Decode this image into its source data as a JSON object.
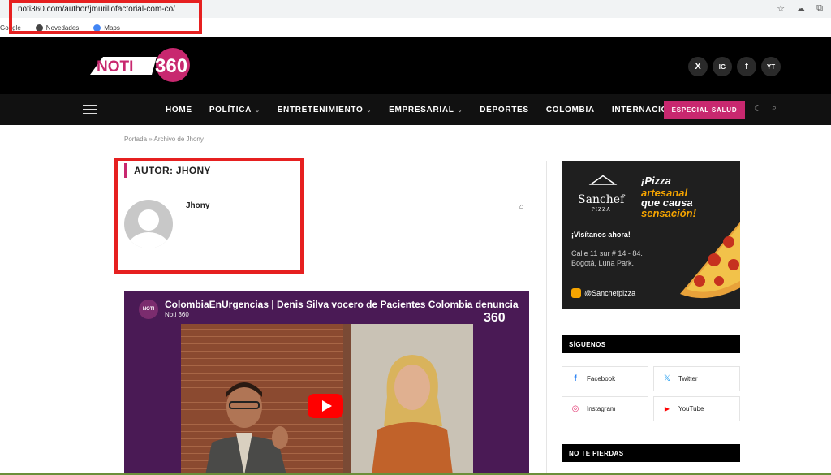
{
  "browser": {
    "url": "noti360.com/author/jmurillofactorial-com-co/",
    "bookmarks": [
      "Google",
      "Novedades",
      "Maps"
    ]
  },
  "header": {
    "logo_text": "NOTI360",
    "social": [
      "X",
      "IG",
      "f",
      "YT"
    ]
  },
  "nav": {
    "items": [
      {
        "label": "HOME",
        "caret": ""
      },
      {
        "label": "POLÍTICA",
        "caret": "⌄"
      },
      {
        "label": "ENTRETENIMIENTO",
        "caret": "⌄"
      },
      {
        "label": "EMPRESARIAL",
        "caret": "⌄"
      },
      {
        "label": "DEPORTES",
        "caret": ""
      },
      {
        "label": "COLOMBIA",
        "caret": ""
      },
      {
        "label": "INTERNACIONAL",
        "caret": ""
      }
    ],
    "special_label": "ESPECIAL SALUD"
  },
  "breadcrumb": {
    "home": "Portada",
    "sep": "»",
    "current": "Archivo de Jhony"
  },
  "author": {
    "heading_prefix": "AUTOR: ",
    "heading_name": "JHONY",
    "name": "Jhony"
  },
  "video": {
    "title": "ColombiaEnUrgencias | Denis Silva vocero de Pacientes Colombia denuncia",
    "channel": "Noti 360",
    "watermark": "360"
  },
  "ad": {
    "brand": "Sanchef",
    "brand_sub": "PIZZA",
    "line1": "¡Pizza",
    "line2": "artesanal",
    "line3": "que causa",
    "line4": "sensación!",
    "visit": "¡Visítanos ahora!",
    "address": "Calle 11 sur # 14  - 84. Bogotá, Luna Park.",
    "instagram": "@Sanchefpizza"
  },
  "sidebar": {
    "follow_title": "SÍGUENOS",
    "social": [
      {
        "label": "Facebook",
        "icon": "f",
        "color": "#1877f2"
      },
      {
        "label": "Twitter",
        "icon": "𝕏",
        "color": "#1d9bf0"
      },
      {
        "label": "Instagram",
        "icon": "◎",
        "color": "#e1306c"
      },
      {
        "label": "YouTube",
        "icon": "▶",
        "color": "#ff0000"
      }
    ],
    "miss_title": "NO TE PIERDAS"
  }
}
